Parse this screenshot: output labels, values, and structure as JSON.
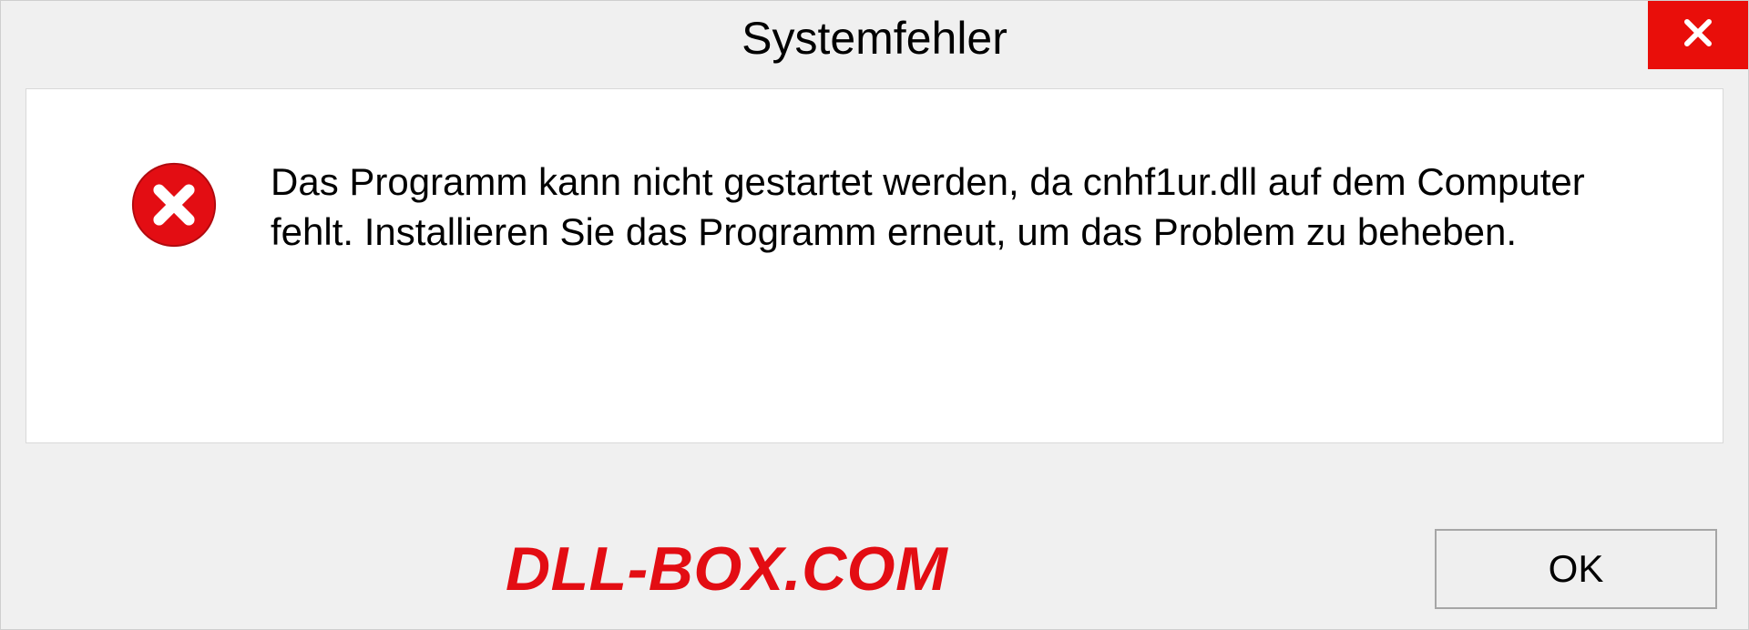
{
  "dialog": {
    "title": "Systemfehler",
    "message": "Das Programm kann nicht gestartet werden, da cnhf1ur.dll auf dem Computer fehlt. Installieren Sie das Programm erneut, um das Problem zu beheben.",
    "ok_label": "OK",
    "watermark": "DLL-BOX.COM",
    "icon": "error-icon",
    "close_icon": "close-icon",
    "colors": {
      "error_red": "#e30d13",
      "close_red": "#e90e0a"
    }
  }
}
